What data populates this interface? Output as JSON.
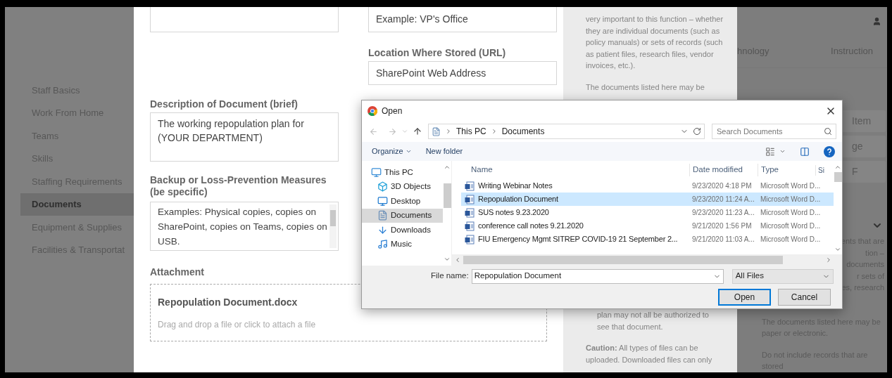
{
  "sidebar": {
    "items": [
      {
        "label": "Staff Basics",
        "selected": false
      },
      {
        "label": "Work From Home",
        "selected": false
      },
      {
        "label": "Teams",
        "selected": false
      },
      {
        "label": "Skills",
        "selected": false
      },
      {
        "label": "Staffing Requirements",
        "selected": false
      },
      {
        "label": "Documents",
        "selected": true
      },
      {
        "label": "Equipment & Supplies",
        "selected": false
      },
      {
        "label": "Facilities & Transportat",
        "selected": false
      }
    ]
  },
  "form": {
    "location_name_field": {
      "value": "Example: VP's Office"
    },
    "location_url": {
      "label": "Location Where Stored (URL)",
      "value": "SharePoint Web Address"
    },
    "description": {
      "label": "Description of Document (brief)",
      "value": "The working repopulation plan for (YOUR DEPARTMENT)"
    },
    "backup": {
      "label": "Backup or Loss-Prevention Measures (be specific)",
      "value": "Examples: Physical copies, copies on SharePoint, copies on Teams, copies on USB."
    },
    "attachment": {
      "label": "Attachment",
      "file_name": "Repopulation Document.docx",
      "hint": "Drag and drop a file or click to attach a file"
    }
  },
  "help_panel": {
    "top_paragraph": "very important to this function – whether they are individual documents (such as policy manuals) or sets of records (such as patient files, research files, vendor invoices, etc.).",
    "second_paragraph": "The documents listed here may be",
    "list_item_end": "plan may not all be authorized to see that document.",
    "caution": "**Caution:** All types of files can be uploaded. Downloaded files can only"
  },
  "right_panel": {
    "tabs": [
      {
        "label": "hnology"
      },
      {
        "label": "Instruction"
      }
    ],
    "buttons": [
      "Item",
      "ge",
      "F"
    ],
    "fragments": [
      "ents that are",
      "tion –",
      "documents",
      "r sets of",
      "es, research"
    ],
    "paragraphs": [
      "The documents listed here may be paper or electronic.",
      "Do not include records that are stored"
    ]
  },
  "dialog": {
    "title": "Open",
    "path": [
      "This PC",
      "Documents"
    ],
    "search": {
      "placeholder": "Search Documents"
    },
    "toolbar": [
      "Organize",
      "New folder"
    ],
    "nav_items": [
      {
        "label": "This PC",
        "kind": "pc",
        "selected": false
      },
      {
        "label": "3D Objects",
        "kind": "cube",
        "selected": false
      },
      {
        "label": "Desktop",
        "kind": "desktop",
        "selected": false
      },
      {
        "label": "Documents",
        "kind": "documents",
        "selected": true
      },
      {
        "label": "Downloads",
        "kind": "downloads",
        "selected": false
      },
      {
        "label": "Music",
        "kind": "music",
        "selected": false
      }
    ],
    "columns": [
      "Name",
      "Date modified",
      "Type",
      "Si"
    ],
    "files": [
      {
        "name": "Writing Webinar Notes",
        "date": "9/23/2020 4:18 PM",
        "type": "Microsoft Word D...",
        "selected": false
      },
      {
        "name": "Repopulation Document",
        "date": "9/23/2020 11:24 A...",
        "type": "Microsoft Word D...",
        "selected": true
      },
      {
        "name": "SUS notes 9.23.2020",
        "date": "9/23/2020 11:23 A...",
        "type": "Microsoft Word D...",
        "selected": false
      },
      {
        "name": "conference call notes 9.21.2020",
        "date": "9/21/2020 1:56 PM",
        "type": "Microsoft Word D...",
        "selected": false
      },
      {
        "name": "FIU Emergency Mgmt SITREP COVID-19 21 September 2...",
        "date": "9/21/2020 11:03 A...",
        "type": "Microsoft Word D...",
        "selected": false
      }
    ],
    "file_name": {
      "label": "File name:",
      "value": "Repopulation Document"
    },
    "file_type": "All Files",
    "buttons": [
      {
        "label": "Open",
        "primary": true
      },
      {
        "label": "Cancel",
        "primary": false
      }
    ]
  }
}
